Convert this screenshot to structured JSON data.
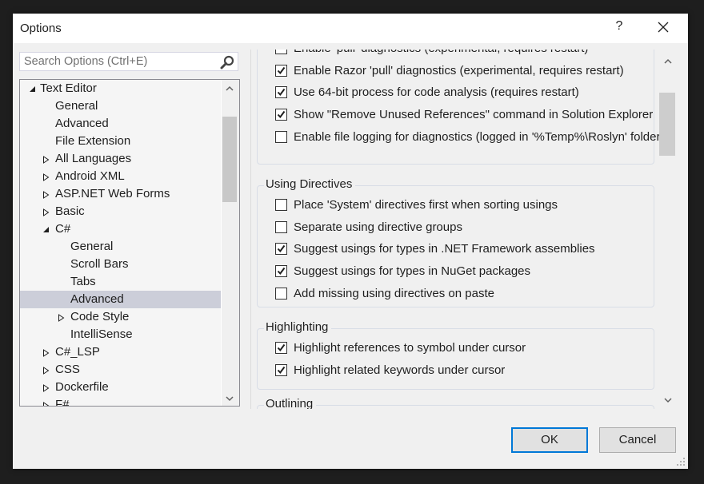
{
  "window": {
    "title": "Options",
    "help_label": "?",
    "close_icon": "close-icon"
  },
  "search": {
    "placeholder": "Search Options (Ctrl+E)",
    "value": "",
    "icon": "search-icon"
  },
  "tree": {
    "items": [
      {
        "label": "Text Editor",
        "level": 0,
        "expander": "expanded"
      },
      {
        "label": "General",
        "level": 1,
        "expander": "none"
      },
      {
        "label": "Advanced",
        "level": 1,
        "expander": "none"
      },
      {
        "label": "File Extension",
        "level": 1,
        "expander": "none"
      },
      {
        "label": "All Languages",
        "level": 1,
        "expander": "collapsed"
      },
      {
        "label": "Android XML",
        "level": 1,
        "expander": "collapsed"
      },
      {
        "label": "ASP.NET Web Forms",
        "level": 1,
        "expander": "collapsed"
      },
      {
        "label": "Basic",
        "level": 1,
        "expander": "collapsed"
      },
      {
        "label": "C#",
        "level": 1,
        "expander": "expanded"
      },
      {
        "label": "General",
        "level": 2,
        "expander": "none"
      },
      {
        "label": "Scroll Bars",
        "level": 2,
        "expander": "none"
      },
      {
        "label": "Tabs",
        "level": 2,
        "expander": "none"
      },
      {
        "label": "Advanced",
        "level": 2,
        "expander": "none",
        "selected": true
      },
      {
        "label": "Code Style",
        "level": 2,
        "expander": "collapsed"
      },
      {
        "label": "IntelliSense",
        "level": 2,
        "expander": "none"
      },
      {
        "label": "C#_LSP",
        "level": 1,
        "expander": "collapsed"
      },
      {
        "label": "CSS",
        "level": 1,
        "expander": "collapsed"
      },
      {
        "label": "Dockerfile",
        "level": 1,
        "expander": "collapsed"
      },
      {
        "label": "F#",
        "level": 1,
        "expander": "collapsed"
      }
    ]
  },
  "content": {
    "top_group": {
      "options": [
        {
          "label": "Enable 'pull' diagnostics (experimental, requires restart)",
          "checked": false
        },
        {
          "label": "Enable Razor 'pull' diagnostics (experimental, requires restart)",
          "checked": true
        },
        {
          "label": "Use 64-bit process for code analysis (requires restart)",
          "checked": true
        },
        {
          "label": "Show \"Remove Unused References\" command in Solution Explorer",
          "checked": true
        },
        {
          "label": "Enable file logging for diagnostics (logged in '%Temp%\\Roslyn' folder)",
          "checked": false
        }
      ]
    },
    "using_directives": {
      "title": "Using Directives",
      "options": [
        {
          "label": "Place 'System' directives first when sorting usings",
          "checked": false
        },
        {
          "label": "Separate using directive groups",
          "checked": false
        },
        {
          "label": "Suggest usings for types in .NET Framework assemblies",
          "checked": true
        },
        {
          "label": "Suggest usings for types in NuGet packages",
          "checked": true
        },
        {
          "label": "Add missing using directives on paste",
          "checked": false
        }
      ]
    },
    "highlighting": {
      "title": "Highlighting",
      "options": [
        {
          "label": "Highlight references to symbol under cursor",
          "checked": true
        },
        {
          "label": "Highlight related keywords under cursor",
          "checked": true
        }
      ]
    },
    "outlining": {
      "title": "Outlining"
    }
  },
  "buttons": {
    "ok_label": "OK",
    "cancel_label": "Cancel"
  }
}
